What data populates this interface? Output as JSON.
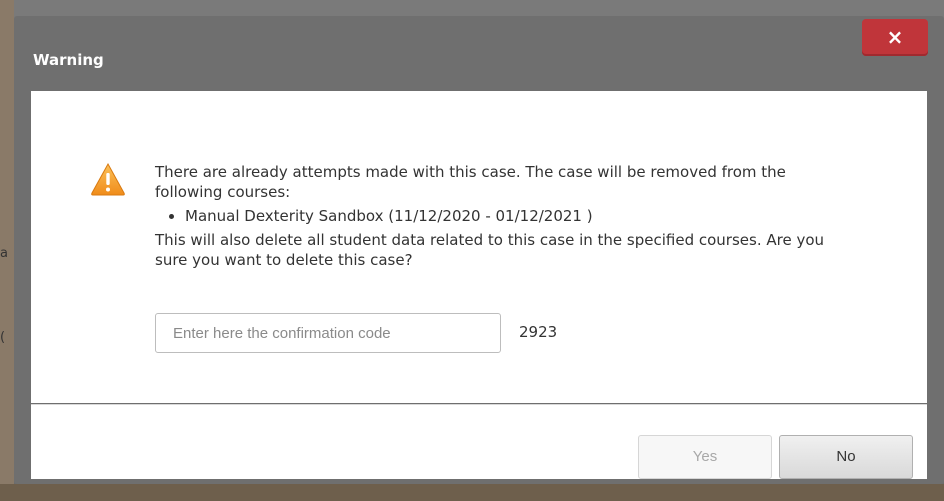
{
  "dialog": {
    "title": "Warning",
    "close_label": "×",
    "message": {
      "intro": "There are already attempts made with this case. The case will be removed from the following courses:",
      "courses": [
        "Manual Dexterity Sandbox (11/12/2020 - 01/12/2021 )"
      ],
      "question": "This will also delete all student data related to this case in the specified courses. Are you sure you want to delete this case?"
    },
    "confirmation": {
      "placeholder": "Enter here the confirmation code",
      "value": "",
      "code": "2923"
    },
    "buttons": {
      "yes": "Yes",
      "no": "No"
    }
  },
  "background_fragments": {
    "frag1": "a",
    "frag2": "("
  },
  "colors": {
    "overlay": "#6f6f6f",
    "close_button": "#c0353a",
    "warning_icon": "#f5a623",
    "title_text": "#ffffff"
  }
}
